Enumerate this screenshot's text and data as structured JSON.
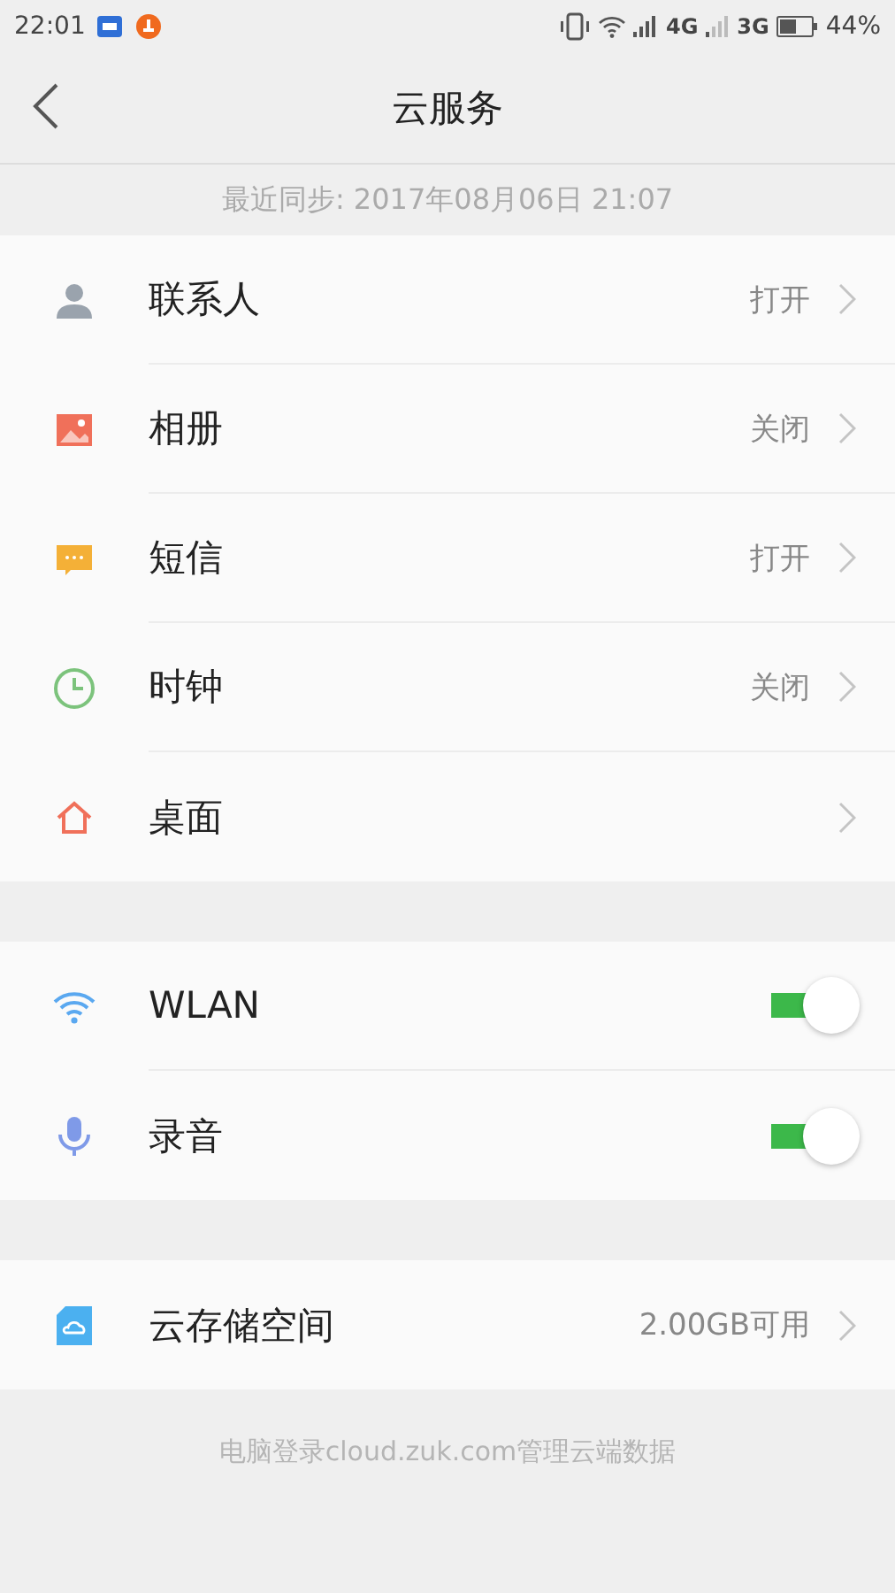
{
  "status_bar": {
    "time": "22:01",
    "network_1": "4G",
    "network_2": "3G",
    "battery": "44%"
  },
  "header": {
    "title": "云服务"
  },
  "sync_info": "最近同步: 2017年08月06日 21:07",
  "groups": [
    {
      "items": [
        {
          "kind": "link",
          "label": "联系人",
          "value": "打开"
        },
        {
          "kind": "link",
          "label": "相册",
          "value": "关闭"
        },
        {
          "kind": "link",
          "label": "短信",
          "value": "打开"
        },
        {
          "kind": "link",
          "label": "时钟",
          "value": "关闭"
        },
        {
          "kind": "link",
          "label": "桌面"
        }
      ]
    },
    {
      "items": [
        {
          "kind": "toggle",
          "label": "WLAN",
          "on": true
        },
        {
          "kind": "toggle",
          "label": "录音",
          "on": true
        }
      ]
    },
    {
      "items": [
        {
          "kind": "link",
          "label": "云存储空间",
          "value": "2.00GB可用"
        }
      ]
    }
  ],
  "footer": "电脑登录cloud.zuk.com管理云端数据"
}
